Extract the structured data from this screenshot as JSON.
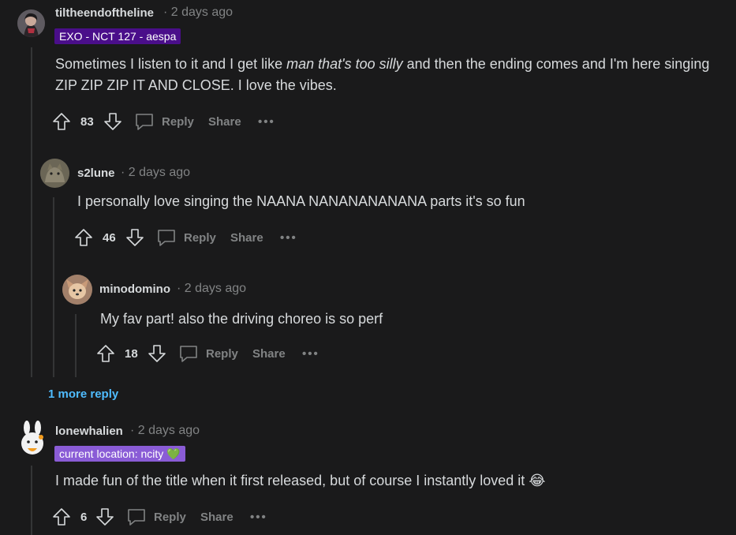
{
  "colors": {
    "background": "#1a1a1b",
    "text": "#d7dadc",
    "meta": "#818384",
    "flair_exo": "#4a0e8a",
    "flair_location": "#8a5cd6",
    "link": "#4fbcff"
  },
  "comments": [
    {
      "username": "tiltheendoftheline",
      "time": "· 2 days ago",
      "flair": "EXO - NCT 127 - aespa",
      "body_pre": "Sometimes I listen to it and I get like ",
      "body_italic": "man that's too silly",
      "body_post": " and then the ending comes and I'm here singing ZIP ZIP ZIP IT AND CLOSE. I love the vibes.",
      "votes": "83",
      "reply": "Reply",
      "share": "Share",
      "more": "•••"
    },
    {
      "username": "s2lune",
      "time": "· 2 days ago",
      "body": "I personally love singing the NAANA NANANANANANA parts it's so fun",
      "votes": "46",
      "reply": "Reply",
      "share": "Share",
      "more": "•••"
    },
    {
      "username": "minodomino",
      "time": "· 2 days ago",
      "body": "My fav part! also the driving choreo is so perf",
      "votes": "18",
      "reply": "Reply",
      "share": "Share",
      "more": "•••"
    },
    {
      "username": "lonewhalien",
      "time": "· 2 days ago",
      "flair": "current location: ncity",
      "flair_emoji": "💚",
      "body": "I made fun of the title when it first released, but of course I instantly loved it",
      "body_emoji": "😂",
      "votes": "6",
      "reply": "Reply",
      "share": "Share",
      "more": "•••"
    }
  ],
  "more_replies": "1 more reply"
}
